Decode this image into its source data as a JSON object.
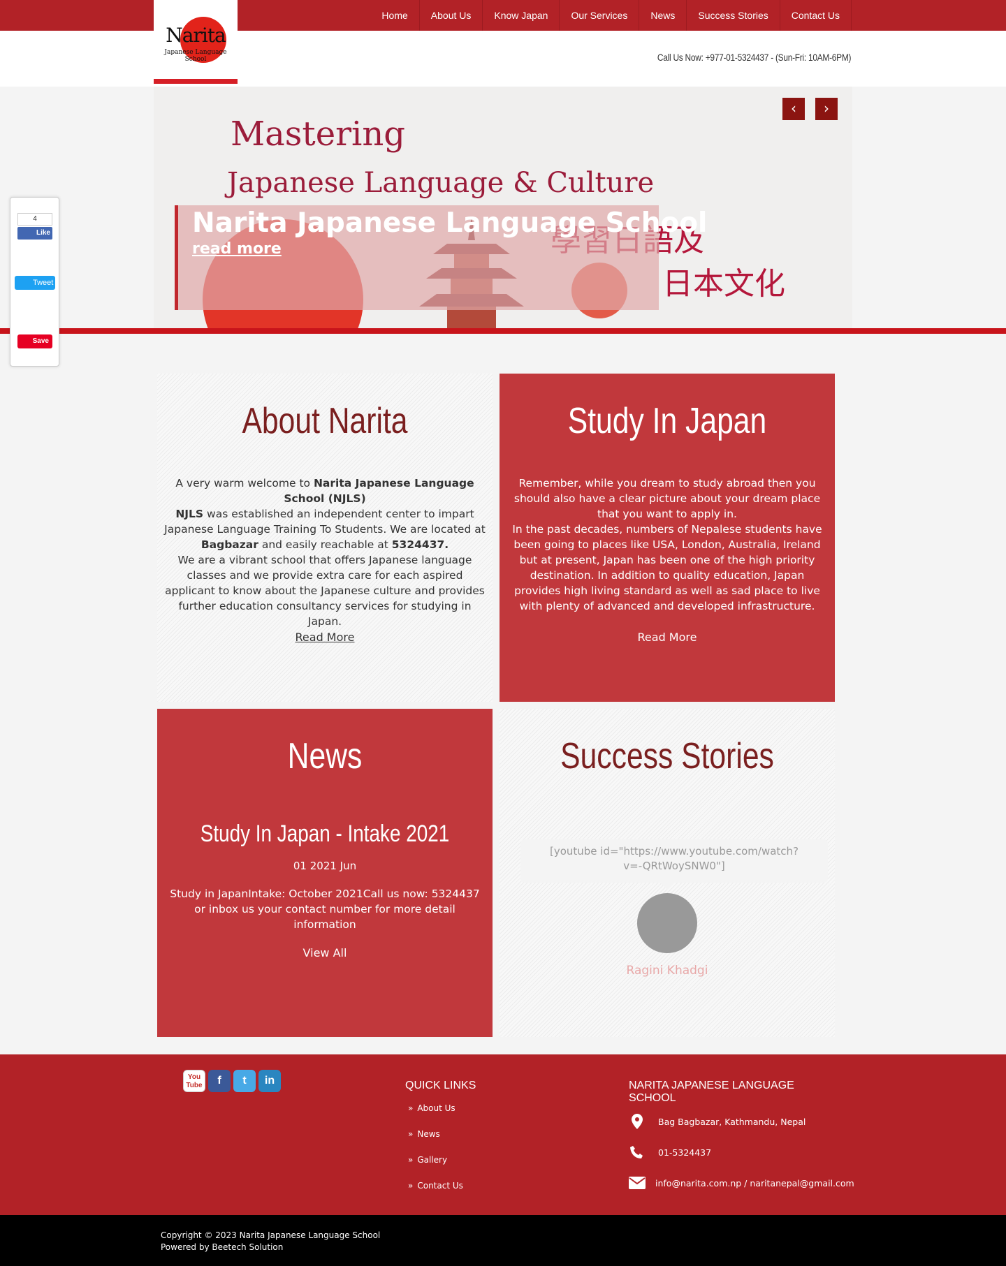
{
  "nav": [
    "Home",
    "About Us",
    "Know Japan",
    "Our Services",
    "News",
    "Success Stories",
    "Contact Us"
  ],
  "logo": {
    "name": "Narita",
    "sub": "Japanese Language School"
  },
  "header": {
    "call": "Call Us Now: +977-01-5324437 - (Sun-Fri: 10AM-6PM)"
  },
  "social_sidebar": {
    "like_count": "4",
    "like": "Like",
    "tweet": "Tweet",
    "save": "Save"
  },
  "slider": {
    "heading1": "Mastering",
    "heading2": "Japanese Language & Culture",
    "kanji1": "學習日語及",
    "kanji2": "日本文化",
    "caption_title": "Narita Japanese Language School",
    "caption_link": "read more",
    "prev": "‹",
    "next": "›"
  },
  "about": {
    "title": "About Narita",
    "p1a": "A very warm welcome to ",
    "p1b": "Narita Japanese Language School (NJLS)",
    "p2a": "NJLS",
    "p2b": " was established an independent center to impart Japanese Language Training To Students. We are located at ",
    "p2c": "Bagbazar",
    "p2d": " and easily reachable at ",
    "p2e": "5324437.",
    "p3": "We are a vibrant school that offers Japanese language classes and we provide extra care for each aspired applicant to know about the Japanese culture and provides further education consultancy services for studying in Japan.",
    "read_more": "Read More"
  },
  "study": {
    "title": "Study In Japan",
    "p1": "Remember, while you dream to study abroad then you should also have a clear picture about your dream place that you want to apply in.",
    "p2": "In the past decades, numbers of Nepalese students have been going to places like USA, London, Australia, Ireland but at present, Japan has been one of the high priority destination. In addition to quality education, Japan provides high living standard as well as sad place to live with plenty of advanced and developed infrastructure.",
    "read_more": "Read More"
  },
  "news": {
    "title": "News",
    "item_title": "Study In Japan - Intake 2021",
    "item_date": "01 2021 Jun",
    "item_text": "Study in JapanIntake: October 2021Call us now: 5324437 or inbox us your contact number for more detail information",
    "view_all": "View All"
  },
  "success": {
    "title": "Success Stories",
    "quote": "[youtube id=\"https://www.youtube.com/watch?v=-QRtWoySNW0\"]",
    "name": "Ragini Khadgi"
  },
  "footer": {
    "quick_title": "QUICK LINKS",
    "quick_links": [
      "About Us",
      "News",
      "Gallery",
      "Contact Us"
    ],
    "contact_title": "NARITA JAPANESE LANGUAGE SCHOOL",
    "address": "Bag Bagbazar, Kathmandu, Nepal",
    "phone": "01-5324437",
    "email": "info@narita.com.np / naritanepal@gmail.com",
    "social": {
      "yt_top": "You",
      "yt_bottom": "Tube",
      "fb": "f",
      "tw": "t",
      "li": "in"
    }
  },
  "copyright": {
    "line1": "Copyright © 2023 Narita Japanese Language School",
    "line2": "Powered by Beetech Solution"
  },
  "colors": {
    "brand_red": "#b22227",
    "box_red": "#c1383c",
    "title_dark_red": "#7a1f1f"
  }
}
